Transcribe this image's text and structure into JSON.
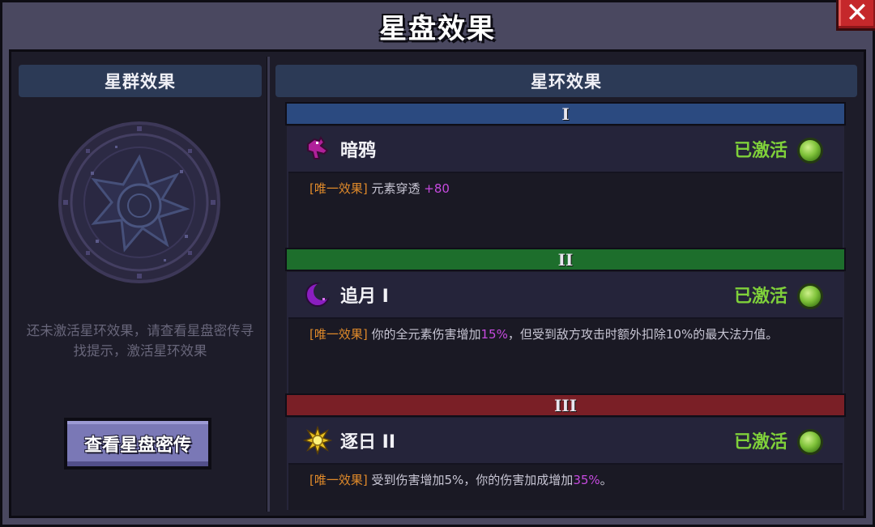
{
  "window": {
    "title": "星盘效果",
    "close_label": "✕"
  },
  "left_panel": {
    "header": "星群效果",
    "hint": "还未激活星环效果，请查看星盘密传寻找提示，激活星环效果",
    "button_label": "查看星盘密传"
  },
  "right_panel": {
    "header": "星环效果",
    "tiers": [
      {
        "numeral": "I",
        "color": "#2b4a80",
        "name": "暗鸦",
        "status": "已激活",
        "tag": "[唯一效果]",
        "text_a": "元素穿透",
        "highlight_a": "+80",
        "text_b": ""
      },
      {
        "numeral": "II",
        "color": "#1d6e2c",
        "name": "追月 I",
        "status": "已激活",
        "tag": "[唯一效果]",
        "text_a": "你的全元素伤害增加",
        "highlight_a": "15%",
        "text_b": "，但受到敌方攻击时额外扣除10%的最大法力值。"
      },
      {
        "numeral": "III",
        "color": "#7a1f26",
        "name": "逐日 II",
        "status": "已激活",
        "tag": "[唯一效果]",
        "text_a": "受到伤害增加5%，你的伤害加成增加",
        "highlight_a": "35%",
        "text_b": "。"
      }
    ]
  },
  "icons": {
    "tier1": "crow-icon",
    "tier2": "crescent-moon-icon",
    "tier3": "sun-icon",
    "status": "green-gem-icon"
  },
  "colors": {
    "accent_green": "#7fd03a",
    "tag_orange": "#e08a2a",
    "highlight_purple": "#c64adf"
  }
}
